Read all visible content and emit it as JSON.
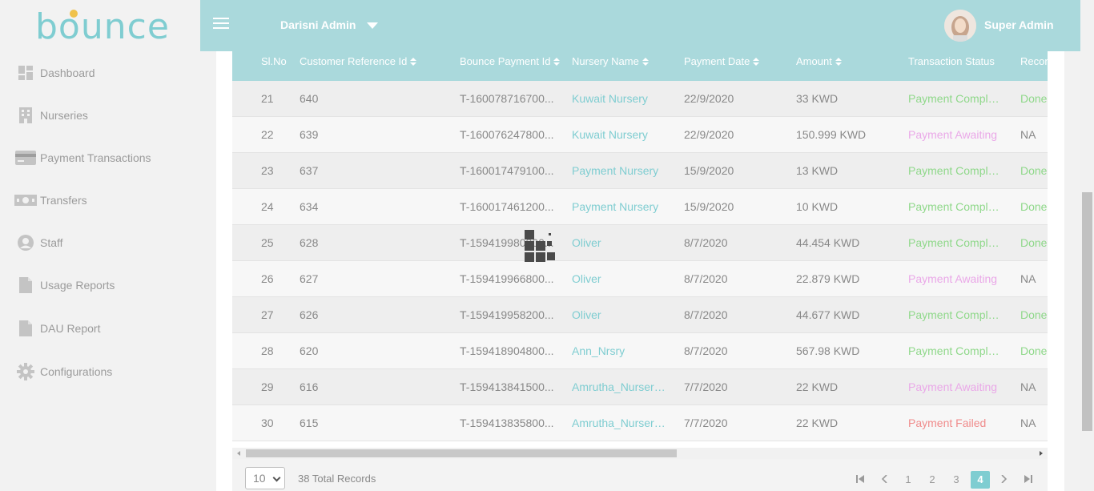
{
  "brand": {
    "logo_text": "bounce",
    "accent": "#7fcdd1",
    "header_bg": "#aad9dc"
  },
  "sidebar": {
    "items": [
      {
        "label": "Dashboard",
        "icon": "dashboard-icon"
      },
      {
        "label": "Nurseries",
        "icon": "building-icon"
      },
      {
        "label": "Payment Transactions",
        "icon": "credit-card-icon"
      },
      {
        "label": "Transfers",
        "icon": "money-icon"
      },
      {
        "label": "Staff",
        "icon": "user-circle-icon"
      },
      {
        "label": "Usage Reports",
        "icon": "file-icon"
      },
      {
        "label": "DAU Report",
        "icon": "file-icon"
      },
      {
        "label": "Configurations",
        "icon": "gear-icon"
      }
    ]
  },
  "header": {
    "org_name": "Darisni Admin",
    "user_name": "Super Admin"
  },
  "table": {
    "headers": {
      "sl": "Sl.No",
      "cref": "Customer Reference Id",
      "pid": "Bounce Payment Id",
      "nursery": "Nursery Name",
      "date": "Payment Date",
      "amount": "Amount",
      "status": "Transaction Status",
      "rec": "Recon"
    },
    "rows": [
      {
        "sl": "21",
        "cref": "640",
        "pid": "T-160078716700...",
        "nursery": "Kuwait Nursery",
        "date": "22/9/2020",
        "amount": "33 KWD",
        "status": "Payment Complet...",
        "status_type": "completed",
        "rec": "Done"
      },
      {
        "sl": "22",
        "cref": "639",
        "pid": "T-160076247800...",
        "nursery": "Kuwait Nursery",
        "date": "22/9/2020",
        "amount": "150.999 KWD",
        "status": "Payment Awaiting",
        "status_type": "awaiting",
        "rec": "NA"
      },
      {
        "sl": "23",
        "cref": "637",
        "pid": "T-160017479100...",
        "nursery": "Payment Nursery",
        "date": "15/9/2020",
        "amount": "13 KWD",
        "status": "Payment Complet...",
        "status_type": "completed",
        "rec": "Done"
      },
      {
        "sl": "24",
        "cref": "634",
        "pid": "T-160017461200...",
        "nursery": "Payment Nursery",
        "date": "15/9/2020",
        "amount": "10 KWD",
        "status": "Payment Complet...",
        "status_type": "completed",
        "rec": "Done"
      },
      {
        "sl": "25",
        "cref": "628",
        "pid": "T-159419980300...",
        "nursery": "Oliver",
        "date": "8/7/2020",
        "amount": "44.454 KWD",
        "status": "Payment Complet...",
        "status_type": "completed",
        "rec": "Done"
      },
      {
        "sl": "26",
        "cref": "627",
        "pid": "T-159419966800...",
        "nursery": "Oliver",
        "date": "8/7/2020",
        "amount": "22.879 KWD",
        "status": "Payment Awaiting",
        "status_type": "awaiting",
        "rec": "NA"
      },
      {
        "sl": "27",
        "cref": "626",
        "pid": "T-159419958200...",
        "nursery": "Oliver",
        "date": "8/7/2020",
        "amount": "44.677 KWD",
        "status": "Payment Complet...",
        "status_type": "completed",
        "rec": "Done"
      },
      {
        "sl": "28",
        "cref": "620",
        "pid": "T-159418904800...",
        "nursery": "Ann_Nrsry",
        "date": "8/7/2020",
        "amount": "567.98 KWD",
        "status": "Payment Complet...",
        "status_type": "completed",
        "rec": "Done"
      },
      {
        "sl": "29",
        "cref": "616",
        "pid": "T-159413841500...",
        "nursery": "Amrutha_Nursery...",
        "date": "7/7/2020",
        "amount": "22 KWD",
        "status": "Payment Awaiting",
        "status_type": "awaiting",
        "rec": "NA"
      },
      {
        "sl": "30",
        "cref": "615",
        "pid": "T-159413835800...",
        "nursery": "Amrutha_Nursery...",
        "date": "7/7/2020",
        "amount": "22 KWD",
        "status": "Payment Failed",
        "status_type": "failed",
        "rec": "NA"
      }
    ]
  },
  "pagination": {
    "page_size": "10",
    "total_records": "38 Total Records",
    "pages": [
      "1",
      "2",
      "3",
      "4"
    ],
    "current_page": "4"
  },
  "status_colors": {
    "completed": "#8fd88a",
    "awaiting": "#eaa8e8",
    "failed": "#f08b8b"
  }
}
